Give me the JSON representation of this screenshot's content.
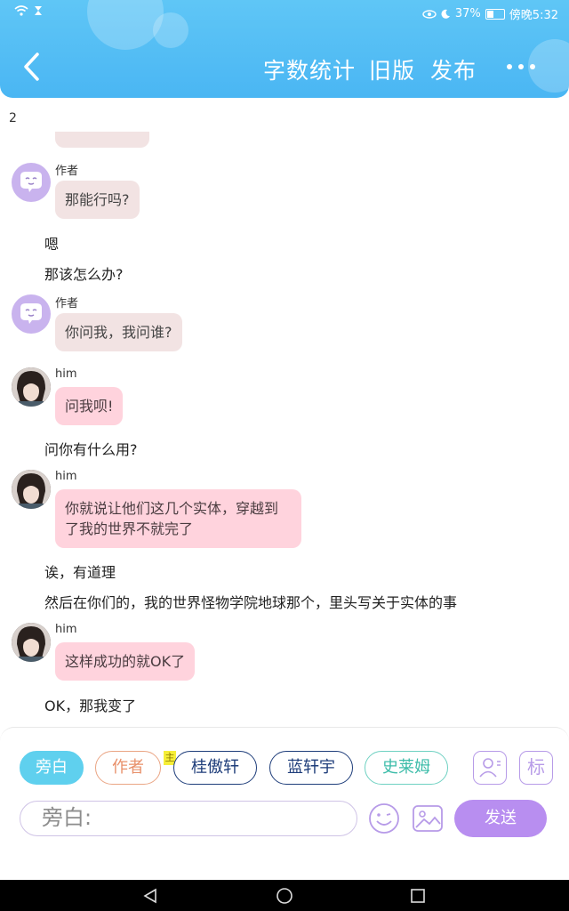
{
  "status_bar": {
    "battery": "37%",
    "time": "傍晚5:32"
  },
  "header": {
    "word_count": "字数统计",
    "old_version": "旧版",
    "publish": "发布"
  },
  "page_number": "2",
  "messages": [
    {
      "speaker": "作者",
      "text": "那能行吗?"
    },
    {
      "narration": "嗯"
    },
    {
      "narration": "那该怎么办?"
    },
    {
      "speaker": "作者",
      "text": "你问我，我问谁?"
    },
    {
      "speaker": "him",
      "text": "问我呗!"
    },
    {
      "narration": "问你有什么用?"
    },
    {
      "speaker": "him",
      "text_lines": [
        "你就说让他们这几个实体，穿越到",
        "了我的世界不就完了"
      ]
    },
    {
      "narration": "诶，有道理"
    },
    {
      "narration": "然后在你们的，我的世界怪物学院地球那个，里头写关于实体的事"
    },
    {
      "speaker": "him",
      "text": "这样成功的就OK了"
    },
    {
      "narration": "OK，那我变了"
    }
  ],
  "roles": {
    "narrator": "旁白",
    "author": "作者",
    "main_mark": "主",
    "role3": "桂傲轩",
    "role4": "蓝轩宇",
    "role5": "史莱姆",
    "tag_button": "标"
  },
  "input": {
    "value": "旁白:"
  },
  "send_button": "发送",
  "colors": {
    "header": "#4ab6f3",
    "him_bubble": "#ffd3dd",
    "author_bubble": "#f2e3e3",
    "send": "#b88ef0",
    "narrator_chip": "#5fd0ee"
  }
}
